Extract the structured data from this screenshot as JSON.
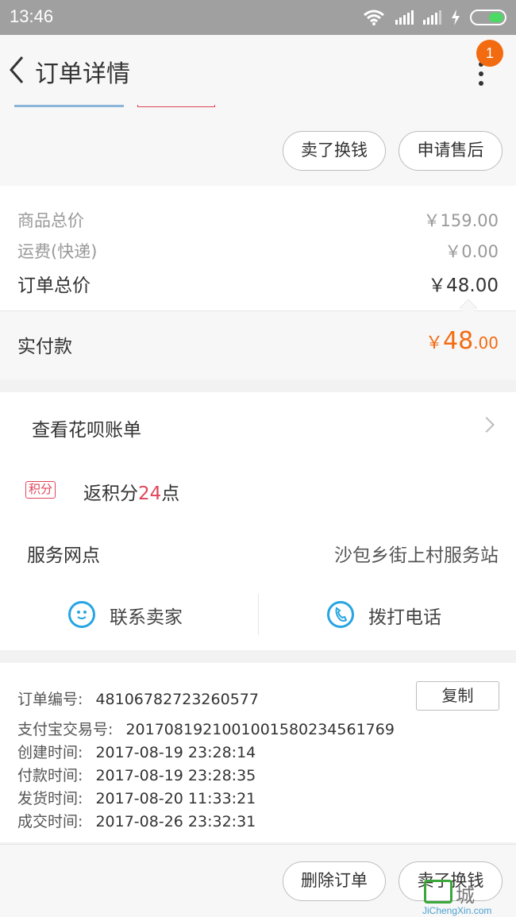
{
  "status_bar": {
    "time": "13:46"
  },
  "nav": {
    "title": "订单详情",
    "badge_count": "1"
  },
  "actions_top": {
    "sell_label": "卖了换钱",
    "after_sale_label": "申请售后"
  },
  "prices": {
    "goods_total_label": "商品总价",
    "goods_total_value": "￥159.00",
    "shipping_label": "运费(快递)",
    "shipping_value": "￥0.00",
    "order_total_label": "订单总价",
    "order_total_value": "￥48.00",
    "paid_label": "实付款",
    "paid_currency": "￥",
    "paid_int": "48",
    "paid_dec": ".00"
  },
  "services": {
    "huabei_label": "查看花呗账单",
    "points_tag": "积分",
    "points_prefix": "返积分",
    "points_value": "24",
    "points_suffix": "点",
    "outlet_label": "服务网点",
    "outlet_value": "沙包乡街上村服务站",
    "contact_seller_label": "联系卖家",
    "call_label": "拨打电话"
  },
  "order_info": {
    "order_no_label": "订单编号:",
    "order_no_value": "48106782723260577",
    "copy_label": "复制",
    "alipay_no_label": "支付宝交易号:",
    "alipay_no_value": "2017081921001001580234561769",
    "created_label": "创建时间:",
    "created_value": "2017-08-19 23:28:14",
    "paid_label": "付款时间:",
    "paid_value": "2017-08-19 23:28:35",
    "shipped_label": "发货时间:",
    "shipped_value": "2017-08-20 11:33:21",
    "closed_label": "成交时间:",
    "closed_value": "2017-08-26 23:32:31"
  },
  "actions_bottom": {
    "delete_label": "删除订单",
    "sell_label": "卖了换钱"
  },
  "watermark": {
    "text": "城",
    "sub": "JiChengXin.com"
  },
  "colors": {
    "accent": "#f26b11",
    "points": "#e0455a",
    "icon_blue": "#27a5e2"
  }
}
